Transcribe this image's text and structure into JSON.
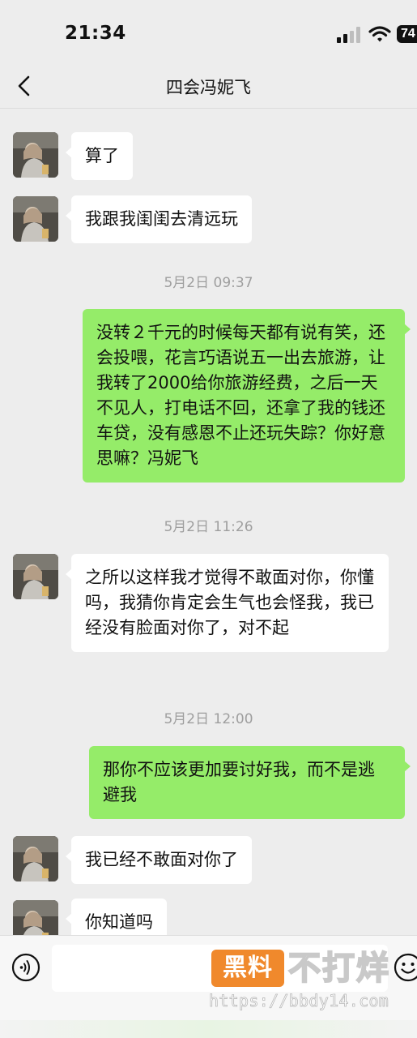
{
  "status_bar": {
    "time": "21:34",
    "battery": "74",
    "icons": [
      "signal-icon",
      "wifi-icon",
      "battery-icon"
    ]
  },
  "nav": {
    "back_icon": "chevron-left-icon",
    "title": "四会冯妮飞"
  },
  "messages": [
    {
      "type": "in",
      "text": "算了"
    },
    {
      "type": "in",
      "text": "我跟我闺闺去清远玩"
    },
    {
      "type": "time",
      "text": "5月2日 09:37"
    },
    {
      "type": "out",
      "text": "没转２千元的时候每天都有说有笑，还会投喂，花言巧语说五一出去旅游，让我转了2000给你旅游经费，之后一天不见人，打电话不回，还拿了我的钱还车贷，没有感恩不止还玩失踪？你好意思嘛？冯妮飞"
    },
    {
      "type": "time",
      "text": "5月2日 11:26"
    },
    {
      "type": "in",
      "text": "之所以这样我才觉得不敢面对你，你懂吗，我猜你肯定会生气也会怪我，我已经没有脸面对你了，对不起"
    },
    {
      "type": "time",
      "text": "5月2日 12:00"
    },
    {
      "type": "out",
      "text": "那你不应该更加要讨好我，而不是逃避我"
    },
    {
      "type": "in",
      "text": "我已经不敢面对你了"
    },
    {
      "type": "in",
      "text": "你知道吗"
    }
  ],
  "input_bar": {
    "voice_icon": "voice-icon",
    "input_value": "",
    "emoji_icon": "emoji-icon"
  },
  "watermark": {
    "badge": "黑料",
    "text": "不打烊",
    "url": "https://bbdy14.com"
  },
  "colors": {
    "background": "#ededed",
    "outgoing_bubble": "#95ec69",
    "incoming_bubble": "#ffffff",
    "timestamp": "#9e9e9e",
    "watermark_badge": "#f0892c"
  }
}
